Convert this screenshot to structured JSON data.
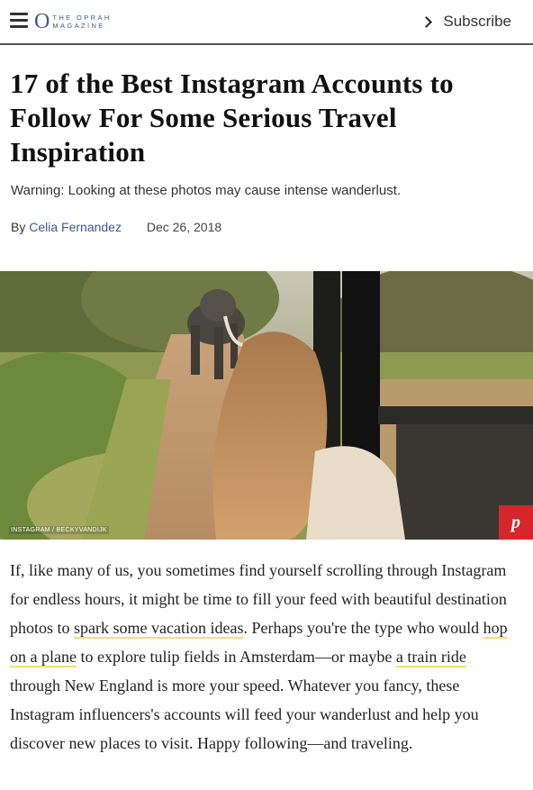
{
  "header": {
    "logo_top": "THE OPRAH",
    "logo_bottom": "MAGAZINE",
    "logo_letter": "O",
    "subscribe_label": "Subscribe"
  },
  "article": {
    "title": "17 of the Best Instagram Accounts to Follow For Some Serious Travel Inspiration",
    "dek": "Warning: Looking at these photos may cause intense wanderlust.",
    "by_label": "By",
    "author": "Celia Fernandez",
    "date": "Dec 26, 2018",
    "photo_credit": "INSTAGRAM / BECKYVANDIJK",
    "body": {
      "p1": "If, like many of us, you sometimes find yourself scrolling through Instagram for endless hours, it might be time to fill your feed with beautiful destination photos to ",
      "link1": "spark some vacation ideas",
      "p2": ". Perhaps you're the type who would ",
      "link2": "hop on a plane",
      "p3": " to explore tulip fields in Amsterdam—or maybe ",
      "link3": "a train ride",
      "p4": " through New England is more your speed. Whatever you fancy, these Instagram influencers's accounts will feed your wanderlust and help you discover new places to visit. Happy following—and traveling."
    }
  },
  "colors": {
    "brand": "#3d5a8c",
    "pinterest": "#d4262b",
    "link_underline": "#f2e06e"
  },
  "icons": [
    "hamburger-menu-icon",
    "chevron-right-icon",
    "pinterest-icon"
  ]
}
